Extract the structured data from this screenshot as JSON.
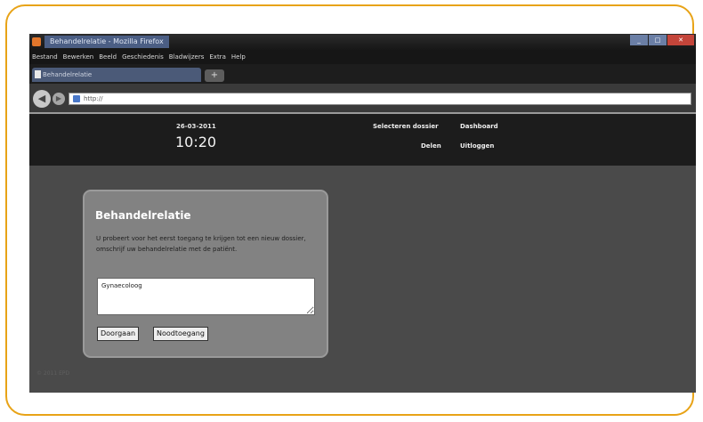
{
  "window": {
    "title": "Behandelrelatie - Mozilla Firefox",
    "controls": [
      "_",
      "□",
      "✕"
    ]
  },
  "menu": [
    "Bestand",
    "Bewerken",
    "Beeld",
    "Geschiedenis",
    "Bladwijzers",
    "Extra",
    "Help"
  ],
  "tab": {
    "label": "Behandelrelatie",
    "new_tab": "+"
  },
  "nav": {
    "back": "◀",
    "forward": "▶",
    "url": "http://"
  },
  "header": {
    "date": "26-03-2011",
    "time": "10:20",
    "links": {
      "select_file": "Selecteren dossier",
      "dashboard": "Dashboard",
      "delete": "Delen",
      "logout": "Uitloggen"
    }
  },
  "dialog": {
    "title": "Behandelrelatie",
    "message": "U probeert voor het eerst toegang te krijgen tot een nieuw dossier, omschrijf uw behandelrelatie met de patiënt.",
    "input_value": "Gynaecoloog",
    "buttons": {
      "continue": "Doorgaan",
      "emergency": "Noodtoegang"
    }
  },
  "footer": {
    "text": "© 2011 EPD"
  },
  "colors": {
    "frame": "#e8a317",
    "header": "#1c1c1c",
    "dialog": "#828282"
  }
}
